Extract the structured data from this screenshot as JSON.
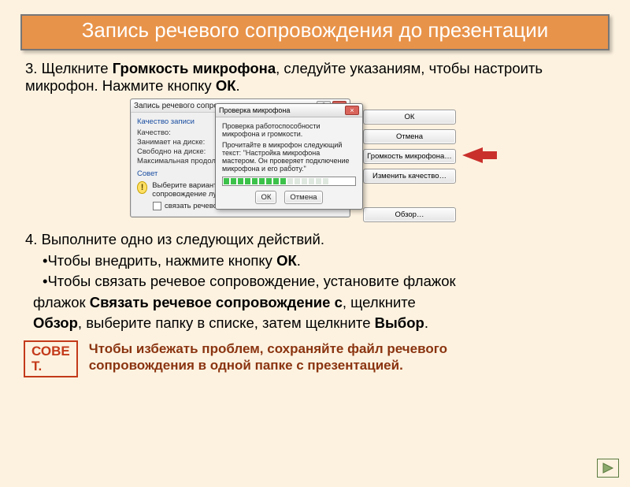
{
  "title": "Запись речевого сопровождения до презентации",
  "step3": {
    "prefix": "3. Щелкните ",
    "bold1": "Громкость микрофона",
    "mid": ", следуйте указаниям, чтобы настроить микрофон. Нажмите кнопку ",
    "bold2": "ОК",
    "suffix": "."
  },
  "step4": {
    "line": "4. Выполните одно из следующих действий.",
    "b1_prefix": "•Чтобы внедрить, нажмите кнопку ",
    "b1_bold": "ОК",
    "b1_suffix": ".",
    "b2_prefix": "•Чтобы связать речевое сопровождение, установите флажок ",
    "b2_bold1": "Связать речевое сопровождение с",
    "b2_mid1": ", щелкните ",
    "b2_bold2": "Обзор",
    "b2_mid2": ", выберите папку в списке, затем щелкните ",
    "b2_bold3": "Выбор",
    "b2_suffix": "."
  },
  "tip": {
    "label": "СОВЕТ.",
    "text": "Чтобы избежать проблем, сохраняйте файл речевого сопровождения в одной папке с презентацией."
  },
  "outer_dialog": {
    "title": "Запись речевого сопровожд",
    "group": "Качество записи",
    "kv": [
      "Качество:",
      "Занимает на диске:",
      "Свободно на диске:",
      "Максимальная продолжительн"
    ],
    "advice_title": "Совет",
    "advice_text": "Выберите вариант, со качественная запись з сопровождение лучше",
    "checkbox": "связать речевое сопровожд",
    "buttons": {
      "ok": "ОК",
      "cancel": "Отмена",
      "mic": "Громкость микрофона…",
      "quality": "Изменить качество…",
      "browse": "Обзор…"
    }
  },
  "inner_dialog": {
    "title": "Проверка микрофона",
    "line1": "Проверка работоспособности микрофона и громкости.",
    "line2": "Прочитайте в микрофон следующий текст: \"Настройка микрофона мастером. Он проверяет подключение микрофона и его работу.\"",
    "ok": "ОК",
    "cancel": "Отмена"
  }
}
